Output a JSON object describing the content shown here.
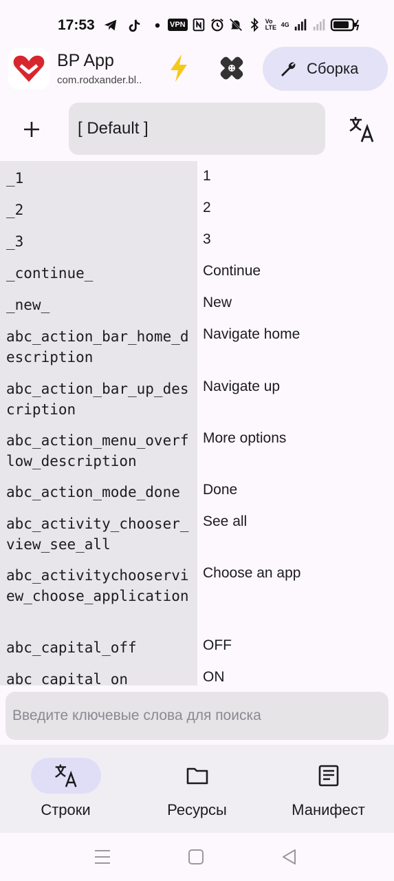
{
  "status_bar": {
    "time": "17:53",
    "vpn": "VPN",
    "volte": "Vo LTE",
    "net": "4G",
    "left_icons": [
      "telegram-icon",
      "tiktok-icon",
      "dot-icon"
    ],
    "right_icons": [
      "nfc-icon",
      "alarm-icon",
      "mute-icon",
      "bluetooth-icon",
      "signal-icon",
      "battery-icon"
    ]
  },
  "app": {
    "name": "BP App",
    "package": "com.rodxander.bl..",
    "build_label": "Сборка"
  },
  "toolbar": {
    "locale": "[ Default ]"
  },
  "strings": [
    {
      "key": "_1",
      "value": "1"
    },
    {
      "key": "_2",
      "value": "2"
    },
    {
      "key": "_3",
      "value": "3"
    },
    {
      "key": "_continue_",
      "value": "Continue"
    },
    {
      "key": "_new_",
      "value": "New"
    },
    {
      "key": "abc_action_bar_home_description",
      "value": "Navigate home"
    },
    {
      "key": "abc_action_bar_up_description",
      "value": "Navigate up"
    },
    {
      "key": "abc_action_menu_overflow_description",
      "value": "More options"
    },
    {
      "key": "abc_action_mode_done",
      "value": "Done"
    },
    {
      "key": "abc_activity_chooser_view_see_all",
      "value": "See all"
    },
    {
      "key": "abc_activitychooserview_choose_application",
      "value": "Choose an app"
    },
    {
      "key": "abc_capital_off",
      "value": "OFF"
    },
    {
      "key": "abc_capital_on",
      "value": "ON"
    }
  ],
  "search": {
    "placeholder": "Введите ключевые слова для поиска",
    "value": ""
  },
  "bottom_nav": [
    {
      "label": "Строки",
      "icon": "translate-icon",
      "active": true
    },
    {
      "label": "Ресурсы",
      "icon": "folder-icon",
      "active": false
    },
    {
      "label": "Манифест",
      "icon": "document-icon",
      "active": false
    }
  ],
  "colors": {
    "background": "#fdf8fd",
    "key_column": "#e8e6ea",
    "build_button": "#e4e2f6",
    "active_nav": "#e0def6",
    "logo_red": "#d8262f",
    "bolt_yellow": "#f6c81b"
  }
}
